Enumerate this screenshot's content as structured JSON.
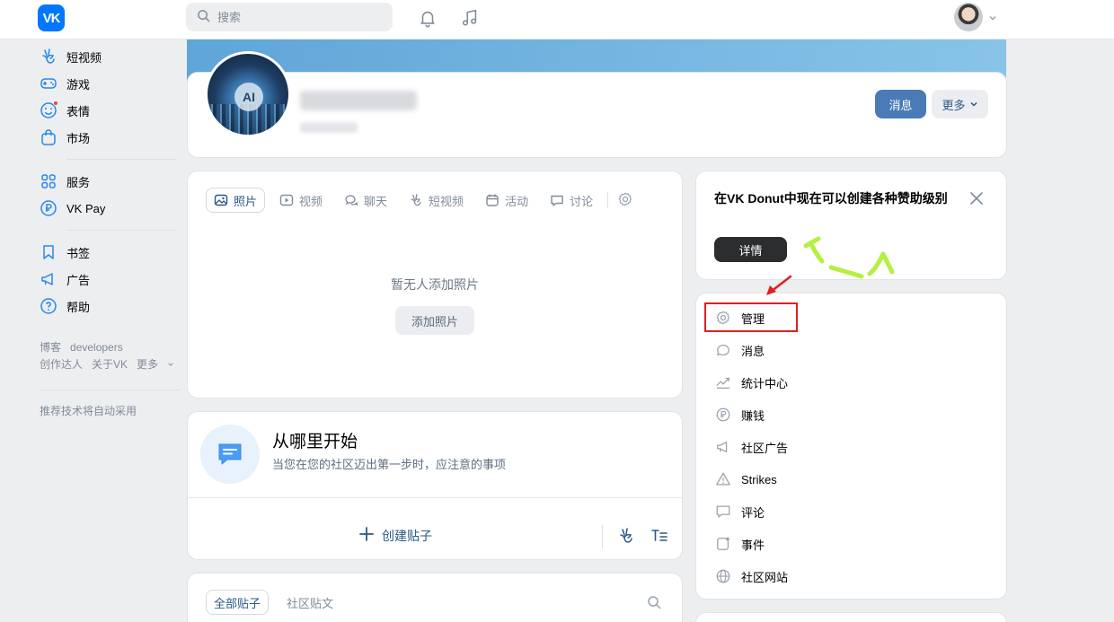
{
  "colors": {
    "brand": "#0077ff",
    "primary_button": "#4a7bb7",
    "link": "#2a5885",
    "annotation_red": "#e02020",
    "annotation_green": "#b4f042"
  },
  "topbar": {
    "logo_text": "VK",
    "search_placeholder": "搜索",
    "icons": [
      "bell-icon",
      "music-icon"
    ]
  },
  "sidebar": {
    "items": [
      {
        "label": "短视频",
        "icon": "clips-icon"
      },
      {
        "label": "游戏",
        "icon": "gamepad-icon"
      },
      {
        "label": "表情",
        "icon": "smile-icon"
      },
      {
        "label": "市场",
        "icon": "bag-icon"
      },
      {
        "label": "服务",
        "icon": "grid-icon"
      },
      {
        "label": "VK Pay",
        "icon": "ruble-icon"
      },
      {
        "label": "书签",
        "icon": "bookmark-icon"
      },
      {
        "label": "广告",
        "icon": "megaphone-icon"
      },
      {
        "label": "帮助",
        "icon": "help-icon"
      }
    ],
    "footer_links_row1": [
      "博客",
      "developers"
    ],
    "footer_links_row2": [
      "创作达人",
      "关于VK",
      "更多"
    ],
    "footer_note": "推荐技术将自动采用"
  },
  "header": {
    "message_button": "消息",
    "more_button": "更多",
    "avatar_text": "AI"
  },
  "photos": {
    "tabs": [
      "照片",
      "视频",
      "聊天",
      "短视频",
      "活动",
      "讨论"
    ],
    "empty_text": "暂无人添加照片",
    "add_button": "添加照片"
  },
  "start": {
    "title": "从哪里开始",
    "subtitle": "当您在您的社区迈出第一步时，应注意的事项",
    "create_post": "创建贴子"
  },
  "posts": {
    "tabs": [
      "全部贴子",
      "社区贴文"
    ]
  },
  "donut": {
    "text": "在VK Donut中现在可以创建各种赞助级别",
    "details_button": "详情"
  },
  "menu": {
    "items": [
      {
        "label": "管理",
        "icon": "gear-icon"
      },
      {
        "label": "消息",
        "icon": "chat-icon"
      },
      {
        "label": "统计中心",
        "icon": "stats-icon"
      },
      {
        "label": "赚钱",
        "icon": "ruble-icon"
      },
      {
        "label": "社区广告",
        "icon": "megaphone-icon"
      },
      {
        "label": "Strikes",
        "icon": "warning-icon"
      },
      {
        "label": "评论",
        "icon": "comment-icon"
      },
      {
        "label": "事件",
        "icon": "event-icon"
      },
      {
        "label": "社区网站",
        "icon": "globe-icon"
      }
    ]
  }
}
